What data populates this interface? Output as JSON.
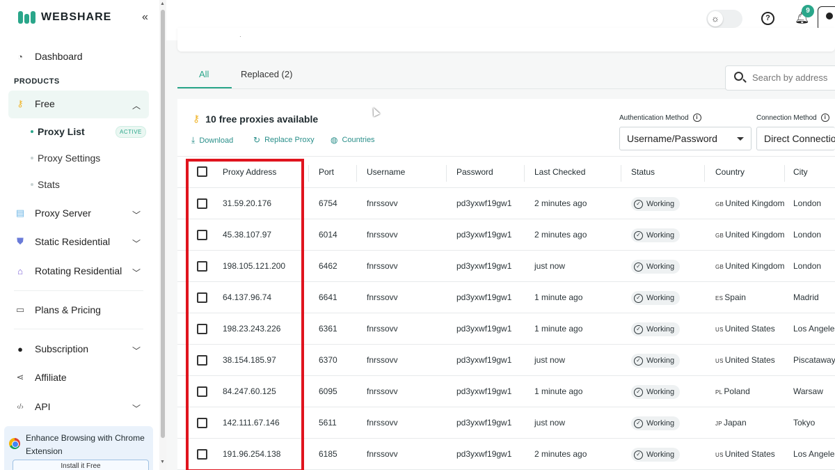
{
  "app": {
    "logo_text": "WEBSHARE"
  },
  "sidebar": {
    "dashboard": "Dashboard",
    "section_products": "PRODUCTS",
    "free": "Free",
    "proxy_list": "Proxy List",
    "active_badge": "ACTIVE",
    "proxy_settings": "Proxy Settings",
    "stats": "Stats",
    "proxy_server": "Proxy Server",
    "static_residential": "Static Residential",
    "rotating_residential": "Rotating Residential",
    "plans_pricing": "Plans & Pricing",
    "subscription": "Subscription",
    "affiliate": "Affiliate",
    "api": "API",
    "promo_text": "Enhance Browsing with Chrome Extension",
    "promo_button": "Install it Free"
  },
  "header": {
    "notification_count": "9"
  },
  "tabs": {
    "all": "All",
    "replaced": "Replaced (2)"
  },
  "search": {
    "placeholder": "Search by address"
  },
  "panel": {
    "proxy_count": "10 free proxies available",
    "download": "Download",
    "replace_proxy": "Replace Proxy",
    "countries": "Countries",
    "auth_label": "Authentication Method",
    "auth_value": "Username/Password",
    "conn_label": "Connection Method",
    "conn_value": "Direct Connection"
  },
  "table": {
    "headers": {
      "proxy_address": "Proxy Address",
      "port": "Port",
      "username": "Username",
      "password": "Password",
      "last_checked": "Last Checked",
      "status": "Status",
      "country": "Country",
      "city": "City"
    },
    "rows": [
      {
        "address": "31.59.20.176",
        "port": "6754",
        "username": "fnrssovv",
        "password": "pd3yxwf19gw1",
        "last_checked": "2 minutes ago",
        "status": "Working",
        "cc": "GB",
        "country": "United Kingdom",
        "city": "London"
      },
      {
        "address": "45.38.107.97",
        "port": "6014",
        "username": "fnrssovv",
        "password": "pd3yxwf19gw1",
        "last_checked": "2 minutes ago",
        "status": "Working",
        "cc": "GB",
        "country": "United Kingdom",
        "city": "London"
      },
      {
        "address": "198.105.121.200",
        "port": "6462",
        "username": "fnrssovv",
        "password": "pd3yxwf19gw1",
        "last_checked": "just now",
        "status": "Working",
        "cc": "GB",
        "country": "United Kingdom",
        "city": "London"
      },
      {
        "address": "64.137.96.74",
        "port": "6641",
        "username": "fnrssovv",
        "password": "pd3yxwf19gw1",
        "last_checked": "1 minute ago",
        "status": "Working",
        "cc": "ES",
        "country": "Spain",
        "city": "Madrid"
      },
      {
        "address": "198.23.243.226",
        "port": "6361",
        "username": "fnrssovv",
        "password": "pd3yxwf19gw1",
        "last_checked": "1 minute ago",
        "status": "Working",
        "cc": "US",
        "country": "United States",
        "city": "Los Angeles"
      },
      {
        "address": "38.154.185.97",
        "port": "6370",
        "username": "fnrssovv",
        "password": "pd3yxwf19gw1",
        "last_checked": "just now",
        "status": "Working",
        "cc": "US",
        "country": "United States",
        "city": "Piscataway"
      },
      {
        "address": "84.247.60.125",
        "port": "6095",
        "username": "fnrssovv",
        "password": "pd3yxwf19gw1",
        "last_checked": "1 minute ago",
        "status": "Working",
        "cc": "PL",
        "country": "Poland",
        "city": "Warsaw"
      },
      {
        "address": "142.111.67.146",
        "port": "5611",
        "username": "fnrssovv",
        "password": "pd3yxwf19gw1",
        "last_checked": "just now",
        "status": "Working",
        "cc": "JP",
        "country": "Japan",
        "city": "Tokyo"
      },
      {
        "address": "191.96.254.138",
        "port": "6185",
        "username": "fnrssovv",
        "password": "pd3yxwf19gw1",
        "last_checked": "2 minutes ago",
        "status": "Working",
        "cc": "US",
        "country": "United States",
        "city": "Los Angeles"
      }
    ]
  },
  "colors": {
    "accent": "#2aa68a",
    "highlight": "#e0141e"
  }
}
